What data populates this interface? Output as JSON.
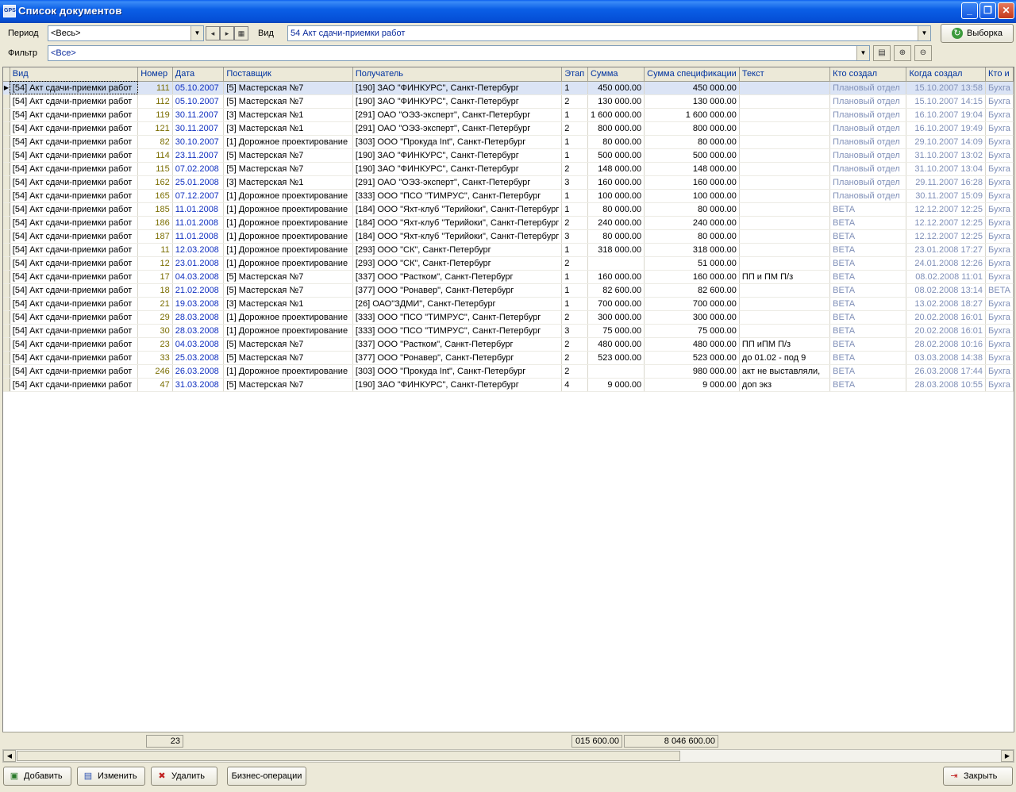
{
  "window": {
    "title": "Список документов",
    "app_icon_text": "GPS"
  },
  "filters": {
    "period_label": "Период",
    "period_value": "<Весь>",
    "vid_label": "Вид",
    "vid_value": "54  Акт сдачи-приемки работ",
    "filter_label": "Фильтр",
    "filter_value": "<Все>",
    "select_button": "Выборка"
  },
  "table": {
    "columns": [
      "Вид",
      "Номер",
      "Дата",
      "Поставщик",
      "Получатель",
      "Этап",
      "Сумма",
      "Сумма спецификации",
      "Текст",
      "Кто создал",
      "Когда создал",
      "Кто и"
    ],
    "rows": [
      [
        "[54]  Акт сдачи-приемки работ",
        "111",
        "05.10.2007",
        "[5]  Мастерская №7",
        "[190]  ЗАО \"ФИНКУРС\", Санкт-Петербург",
        "1",
        "450 000.00",
        "450 000.00",
        "",
        "Плановый отдел",
        "15.10.2007 13:58",
        "Бухга"
      ],
      [
        "[54]  Акт сдачи-приемки работ",
        "112",
        "05.10.2007",
        "[5]  Мастерская №7",
        "[190]  ЗАО \"ФИНКУРС\", Санкт-Петербург",
        "2",
        "130 000.00",
        "130 000.00",
        "",
        "Плановый отдел",
        "15.10.2007 14:15",
        "Бухга"
      ],
      [
        "[54]  Акт сдачи-приемки работ",
        "119",
        "30.11.2007",
        "[3]  Мастерская №1",
        "[291]  ОАО \"ОЭЗ-эксперт\", Санкт-Петербург",
        "1",
        "1 600 000.00",
        "1 600 000.00",
        "",
        "Плановый отдел",
        "16.10.2007 19:04",
        "Бухга"
      ],
      [
        "[54]  Акт сдачи-приемки работ",
        "121",
        "30.11.2007",
        "[3]  Мастерская №1",
        "[291]  ОАО \"ОЭЗ-эксперт\", Санкт-Петербург",
        "2",
        "800 000.00",
        "800 000.00",
        "",
        "Плановый отдел",
        "16.10.2007 19:49",
        "Бухга"
      ],
      [
        "[54]  Акт сдачи-приемки работ",
        "82",
        "30.10.2007",
        "[1]  Дорожное проектирование",
        "[303]  ООО \"Прокуда Int\", Санкт-Петербург",
        "1",
        "80 000.00",
        "80 000.00",
        "",
        "Плановый отдел",
        "29.10.2007 14:09",
        "Бухга"
      ],
      [
        "[54]  Акт сдачи-приемки работ",
        "114",
        "23.11.2007",
        "[5]  Мастерская №7",
        "[190]  ЗАО \"ФИНКУРС\", Санкт-Петербург",
        "1",
        "500 000.00",
        "500 000.00",
        "",
        "Плановый отдел",
        "31.10.2007 13:02",
        "Бухга"
      ],
      [
        "[54]  Акт сдачи-приемки работ",
        "115",
        "07.02.2008",
        "[5]  Мастерская №7",
        "[190]  ЗАО \"ФИНКУРС\", Санкт-Петербург",
        "2",
        "148 000.00",
        "148 000.00",
        "",
        "Плановый отдел",
        "31.10.2007 13:04",
        "Бухга"
      ],
      [
        "[54]  Акт сдачи-приемки работ",
        "162",
        "25.01.2008",
        "[3]  Мастерская №1",
        "[291]  ОАО \"ОЭЗ-эксперт\", Санкт-Петербург",
        "3",
        "160 000.00",
        "160 000.00",
        "",
        "Плановый отдел",
        "29.11.2007 16:28",
        "Бухга"
      ],
      [
        "[54]  Акт сдачи-приемки работ",
        "165",
        "07.12.2007",
        "[1]  Дорожное проектирование",
        "[333]  ООО \"ПСО \"ТИМРУС\", Санкт-Петербург",
        "1",
        "100 000.00",
        "100 000.00",
        "",
        "Плановый отдел",
        "30.11.2007 15:09",
        "Бухга"
      ],
      [
        "[54]  Акт сдачи-приемки работ",
        "185",
        "11.01.2008",
        "[1]  Дорожное проектирование",
        "[184]  ООО \"Яхт-клуб \"Терийоки\", Санкт-Петербург",
        "1",
        "80 000.00",
        "80 000.00",
        "",
        "BETA",
        "12.12.2007 12:25",
        "Бухга"
      ],
      [
        "[54]  Акт сдачи-приемки работ",
        "186",
        "11.01.2008",
        "[1]  Дорожное проектирование",
        "[184]  ООО \"Яхт-клуб \"Терийоки\", Санкт-Петербург",
        "2",
        "240 000.00",
        "240 000.00",
        "",
        "BETA",
        "12.12.2007 12:25",
        "Бухга"
      ],
      [
        "[54]  Акт сдачи-приемки работ",
        "187",
        "11.01.2008",
        "[1]  Дорожное проектирование",
        "[184]  ООО \"Яхт-клуб \"Терийоки\", Санкт-Петербург",
        "3",
        "80 000.00",
        "80 000.00",
        "",
        "BETA",
        "12.12.2007 12:25",
        "Бухга"
      ],
      [
        "[54]  Акт сдачи-приемки работ",
        "11",
        "12.03.2008",
        "[1]  Дорожное проектирование",
        "[293]  ООО \"СК\", Санкт-Петербург",
        "1",
        "318 000.00",
        "318 000.00",
        "",
        "BETA",
        "23.01.2008 17:27",
        "Бухга"
      ],
      [
        "[54]  Акт сдачи-приемки работ",
        "12",
        "23.01.2008",
        "[1]  Дорожное проектирование",
        "[293]  ООО \"СК\", Санкт-Петербург",
        "2",
        "",
        "51 000.00",
        "",
        "BETA",
        "24.01.2008 12:26",
        "Бухга"
      ],
      [
        "[54]  Акт сдачи-приемки работ",
        "17",
        "04.03.2008",
        "[5]  Мастерская №7",
        "[337]  ООО \"Растком\", Санкт-Петербург",
        "1",
        "160 000.00",
        "160 000.00",
        "ПП и ПМ П/з",
        "BETA",
        "08.02.2008 11:01",
        "Бухга"
      ],
      [
        "[54]  Акт сдачи-приемки работ",
        "18",
        "21.02.2008",
        "[5]  Мастерская №7",
        "[377]  ООО \"Ронавер\", Санкт-Петербург",
        "1",
        "82 600.00",
        "82 600.00",
        "",
        "BETA",
        "08.02.2008 13:14",
        "BETA"
      ],
      [
        "[54]  Акт сдачи-приемки работ",
        "21",
        "19.03.2008",
        "[3]  Мастерская №1",
        "[26]  ОАО\"ЗДМИ\", Санкт-Петербург",
        "1",
        "700 000.00",
        "700 000.00",
        "",
        "BETA",
        "13.02.2008 18:27",
        "Бухга"
      ],
      [
        "[54]  Акт сдачи-приемки работ",
        "29",
        "28.03.2008",
        "[1]  Дорожное проектирование",
        "[333]  ООО \"ПСО \"ТИМРУС\", Санкт-Петербург",
        "2",
        "300 000.00",
        "300 000.00",
        "",
        "BETA",
        "20.02.2008 16:01",
        "Бухга"
      ],
      [
        "[54]  Акт сдачи-приемки работ",
        "30",
        "28.03.2008",
        "[1]  Дорожное проектирование",
        "[333]  ООО \"ПСО \"ТИМРУС\", Санкт-Петербург",
        "3",
        "75 000.00",
        "75 000.00",
        "",
        "BETA",
        "20.02.2008 16:01",
        "Бухга"
      ],
      [
        "[54]  Акт сдачи-приемки работ",
        "23",
        "04.03.2008",
        "[5]  Мастерская №7",
        "[337]  ООО \"Растком\", Санкт-Петербург",
        "2",
        "480 000.00",
        "480 000.00",
        "ПП иПМ П/з",
        "BETA",
        "28.02.2008 10:16",
        "Бухга"
      ],
      [
        "[54]  Акт сдачи-приемки работ",
        "33",
        "25.03.2008",
        "[5]  Мастерская №7",
        "[377]  ООО \"Ронавер\", Санкт-Петербург",
        "2",
        "523 000.00",
        "523 000.00",
        "до 01.02 - под 9",
        "BETA",
        "03.03.2008 14:38",
        "Бухга"
      ],
      [
        "[54]  Акт сдачи-приемки работ",
        "246",
        "26.03.2008",
        "[1]  Дорожное проектирование",
        "[303]  ООО \"Прокуда Int\", Санкт-Петербург",
        "2",
        "",
        "980 000.00",
        "акт не выставляли,",
        "BETA",
        "26.03.2008 17:44",
        "Бухга"
      ],
      [
        "[54]  Акт сдачи-приемки работ",
        "47",
        "31.03.2008",
        "[5]  Мастерская №7",
        "[190]  ЗАО \"ФИНКУРС\", Санкт-Петербург",
        "4",
        "9 000.00",
        "9 000.00",
        "доп экз",
        "BETA",
        "28.03.2008 10:55",
        "Бухга"
      ]
    ]
  },
  "totals": {
    "count": "23",
    "sum": "015 600.00",
    "spec_sum": "8 046 600.00"
  },
  "buttons": {
    "add": "Добавить",
    "edit": "Изменить",
    "delete": "Удалить",
    "business_ops": "Бизнес-операции",
    "close": "Закрыть"
  }
}
